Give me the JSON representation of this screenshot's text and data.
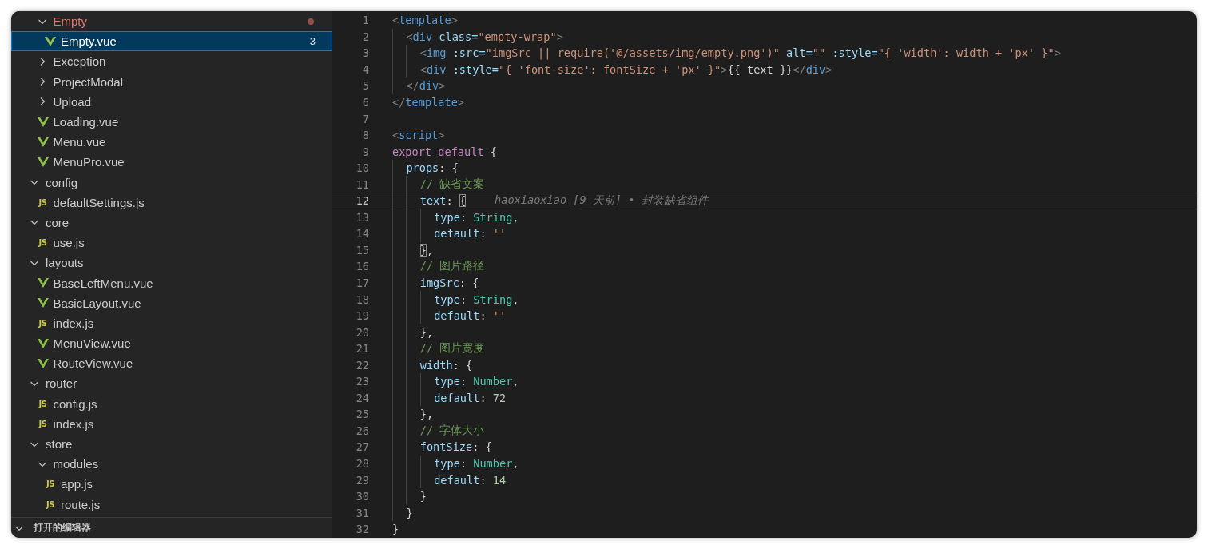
{
  "explorer": {
    "scrolled_items": [
      {
        "name": "Empty",
        "kind": "folder",
        "expanded": true,
        "modified": true,
        "children": [
          {
            "name": "Empty.vue",
            "kind": "vue",
            "selected": true,
            "badge": "3"
          }
        ]
      },
      {
        "name": "Exception",
        "kind": "folder",
        "expanded": false
      },
      {
        "name": "ProjectModal",
        "kind": "folder",
        "expanded": false
      },
      {
        "name": "Upload",
        "kind": "folder",
        "expanded": false
      },
      {
        "name": "Loading.vue",
        "kind": "vue",
        "selected": false
      },
      {
        "name": "Menu.vue",
        "kind": "vue",
        "selected": false
      },
      {
        "name": "MenuPro.vue",
        "kind": "vue",
        "selected": false
      }
    ],
    "items": [
      {
        "name": "config",
        "kind": "folder",
        "expanded": true,
        "children": [
          {
            "name": "defaultSettings.js",
            "kind": "js",
            "icon": "JS",
            "selected": false
          }
        ]
      },
      {
        "name": "core",
        "kind": "folder",
        "expanded": true,
        "children": [
          {
            "name": "use.js",
            "kind": "js",
            "icon": "JS",
            "selected": false
          }
        ]
      },
      {
        "name": "layouts",
        "kind": "folder",
        "expanded": true,
        "children": [
          {
            "name": "BaseLeftMenu.vue",
            "kind": "vue",
            "selected": false
          },
          {
            "name": "BasicLayout.vue",
            "kind": "vue",
            "selected": false
          },
          {
            "name": "index.js",
            "kind": "js",
            "icon": "JS",
            "selected": false
          },
          {
            "name": "MenuView.vue",
            "kind": "vue",
            "selected": false
          },
          {
            "name": "RouteView.vue",
            "kind": "vue",
            "selected": false
          }
        ]
      },
      {
        "name": "router",
        "kind": "folder",
        "expanded": true,
        "children": [
          {
            "name": "config.js",
            "kind": "js",
            "icon": "JS",
            "selected": false
          },
          {
            "name": "index.js",
            "kind": "js",
            "icon": "JS",
            "selected": false
          }
        ]
      },
      {
        "name": "store",
        "kind": "folder",
        "expanded": true,
        "children": [
          {
            "name": "modules",
            "kind": "folder",
            "expanded": true,
            "children": [
              {
                "name": "app.js",
                "kind": "js",
                "icon": "JS",
                "selected": false
              },
              {
                "name": "route.js",
                "kind": "js",
                "icon": "JS",
                "selected": false
              }
            ]
          }
        ]
      }
    ],
    "open_editors": {
      "title": "打开的编辑器",
      "expanded": true
    }
  },
  "editor": {
    "lines": [
      {
        "number": "1",
        "tokens": [
          {
            "text": "<",
            "kind": "punct"
          },
          {
            "text": "template",
            "kind": "tag"
          },
          {
            "text": ">",
            "kind": "punct"
          }
        ]
      },
      {
        "number": "2",
        "tokens": [
          {
            "text": "  <",
            "kind": "punct"
          },
          {
            "text": "div",
            "kind": "tag"
          },
          {
            "text": " class=",
            "kind": "attr"
          },
          {
            "text": "\"empty-wrap\"",
            "kind": "string"
          },
          {
            "text": ">",
            "kind": "punct"
          }
        ]
      },
      {
        "number": "3",
        "tokens": [
          {
            "text": "    <",
            "kind": "punct"
          },
          {
            "text": "img",
            "kind": "tag"
          },
          {
            "text": " :src=",
            "kind": "attr"
          },
          {
            "text": "\"imgSrc || require('@/assets/img/empty.png')\"",
            "kind": "string"
          },
          {
            "text": " alt=",
            "kind": "attr"
          },
          {
            "text": "\"\"",
            "kind": "string"
          },
          {
            "text": " :style=",
            "kind": "attr"
          },
          {
            "text": "\"{ 'width': width + 'px' }\"",
            "kind": "string"
          },
          {
            "text": ">",
            "kind": "punct"
          }
        ]
      },
      {
        "number": "4",
        "tokens": [
          {
            "text": "    <",
            "kind": "punct"
          },
          {
            "text": "div",
            "kind": "tag"
          },
          {
            "text": " :style=",
            "kind": "attr"
          },
          {
            "text": "\"{ 'font-size': fontSize + 'px' }\"",
            "kind": "string"
          },
          {
            "text": ">",
            "kind": "punct"
          },
          {
            "text": "{{ text }}",
            "kind": "plain"
          },
          {
            "text": "</",
            "kind": "punct"
          },
          {
            "text": "div",
            "kind": "tag"
          },
          {
            "text": ">",
            "kind": "punct"
          }
        ]
      },
      {
        "number": "5",
        "tokens": [
          {
            "text": "  </",
            "kind": "punct"
          },
          {
            "text": "div",
            "kind": "tag"
          },
          {
            "text": ">",
            "kind": "punct"
          }
        ]
      },
      {
        "number": "6",
        "tokens": [
          {
            "text": "</",
            "kind": "punct"
          },
          {
            "text": "template",
            "kind": "tag"
          },
          {
            "text": ">",
            "kind": "punct"
          }
        ]
      },
      {
        "number": "7"
      },
      {
        "number": "8",
        "tokens": [
          {
            "text": "<",
            "kind": "punct"
          },
          {
            "text": "script",
            "kind": "tag"
          },
          {
            "text": ">",
            "kind": "punct"
          }
        ]
      },
      {
        "number": "9",
        "tokens": [
          {
            "text": "export default",
            "kind": "keyword"
          },
          {
            "text": " {",
            "kind": "plain"
          }
        ]
      },
      {
        "number": "10",
        "tokens": [
          {
            "text": "  props",
            "kind": "prop"
          },
          {
            "text": ": {",
            "kind": "plain"
          }
        ]
      },
      {
        "number": "11",
        "tokens": [
          {
            "text": "    // 缺省文案",
            "kind": "comment"
          }
        ]
      },
      {
        "number": "12",
        "current": true,
        "blame": "haoxiaoxiao [9 天前] • 封装缺省组件",
        "tokens": [
          {
            "text": "    text",
            "kind": "prop"
          },
          {
            "text": ": ",
            "kind": "plain"
          },
          {
            "text": "{",
            "kind": "plain",
            "match": true
          }
        ]
      },
      {
        "number": "13",
        "tokens": [
          {
            "text": "      type",
            "kind": "prop"
          },
          {
            "text": ": ",
            "kind": "plain"
          },
          {
            "text": "String",
            "kind": "type"
          },
          {
            "text": ",",
            "kind": "plain"
          }
        ]
      },
      {
        "number": "14",
        "tokens": [
          {
            "text": "      default",
            "kind": "prop"
          },
          {
            "text": ": ",
            "kind": "plain"
          },
          {
            "text": "''",
            "kind": "string"
          }
        ]
      },
      {
        "number": "15",
        "tokens": [
          {
            "text": "    }",
            "kind": "plain",
            "match": true
          },
          {
            "text": ",",
            "kind": "plain"
          }
        ]
      },
      {
        "number": "16",
        "tokens": [
          {
            "text": "    // 图片路径",
            "kind": "comment"
          }
        ]
      },
      {
        "number": "17",
        "tokens": [
          {
            "text": "    imgSrc",
            "kind": "prop"
          },
          {
            "text": ": {",
            "kind": "plain"
          }
        ]
      },
      {
        "number": "18",
        "tokens": [
          {
            "text": "      type",
            "kind": "prop"
          },
          {
            "text": ": ",
            "kind": "plain"
          },
          {
            "text": "String",
            "kind": "type"
          },
          {
            "text": ",",
            "kind": "plain"
          }
        ]
      },
      {
        "number": "19",
        "tokens": [
          {
            "text": "      default",
            "kind": "prop"
          },
          {
            "text": ": ",
            "kind": "plain"
          },
          {
            "text": "''",
            "kind": "string"
          }
        ]
      },
      {
        "number": "20",
        "tokens": [
          {
            "text": "    },",
            "kind": "plain"
          }
        ]
      },
      {
        "number": "21",
        "tokens": [
          {
            "text": "    // 图片宽度",
            "kind": "comment"
          }
        ]
      },
      {
        "number": "22",
        "tokens": [
          {
            "text": "    width",
            "kind": "prop"
          },
          {
            "text": ": {",
            "kind": "plain"
          }
        ]
      },
      {
        "number": "23",
        "tokens": [
          {
            "text": "      type",
            "kind": "prop"
          },
          {
            "text": ": ",
            "kind": "plain"
          },
          {
            "text": "Number",
            "kind": "type"
          },
          {
            "text": ",",
            "kind": "plain"
          }
        ]
      },
      {
        "number": "24",
        "tokens": [
          {
            "text": "      default",
            "kind": "prop"
          },
          {
            "text": ": ",
            "kind": "plain"
          },
          {
            "text": "72",
            "kind": "number"
          }
        ]
      },
      {
        "number": "25",
        "tokens": [
          {
            "text": "    },",
            "kind": "plain"
          }
        ]
      },
      {
        "number": "26",
        "tokens": [
          {
            "text": "    // 字体大小",
            "kind": "comment"
          }
        ]
      },
      {
        "number": "27",
        "tokens": [
          {
            "text": "    fontSize",
            "kind": "prop"
          },
          {
            "text": ": {",
            "kind": "plain"
          }
        ]
      },
      {
        "number": "28",
        "tokens": [
          {
            "text": "      type",
            "kind": "prop"
          },
          {
            "text": ": ",
            "kind": "plain"
          },
          {
            "text": "Number",
            "kind": "type"
          },
          {
            "text": ",",
            "kind": "plain"
          }
        ]
      },
      {
        "number": "29",
        "tokens": [
          {
            "text": "      default",
            "kind": "prop"
          },
          {
            "text": ": ",
            "kind": "plain"
          },
          {
            "text": "14",
            "kind": "number"
          }
        ]
      },
      {
        "number": "30",
        "tokens": [
          {
            "text": "    }",
            "kind": "plain"
          }
        ]
      },
      {
        "number": "31",
        "tokens": [
          {
            "text": "  }",
            "kind": "plain"
          }
        ]
      },
      {
        "number": "32",
        "tokens": [
          {
            "text": "}",
            "kind": "plain"
          }
        ]
      }
    ]
  }
}
